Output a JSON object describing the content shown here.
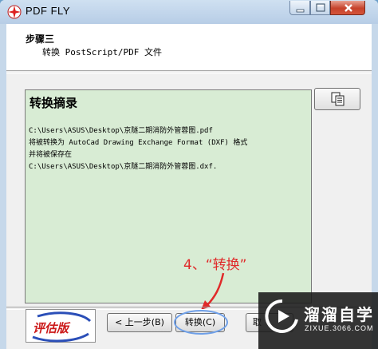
{
  "window": {
    "title": "PDF FLY"
  },
  "header": {
    "step_title": "步骤三",
    "step_subtitle": "转换 PostScript/PDF 文件"
  },
  "summary": {
    "title": "转换摘录",
    "lines": [
      "C:\\Users\\ASUS\\Desktop\\京隧二期消防外管蓉图.pdf",
      "将被转换为 AutoCad Drawing Exchange Format (DXF) 格式",
      "并将被保存在",
      "C:\\Users\\ASUS\\Desktop\\京隧二期消防外管蓉图.dxf."
    ]
  },
  "annotation": {
    "text": "4、“转换”",
    "color": "#e02a2a"
  },
  "buttons": {
    "back": "< 上一步(B)",
    "convert": "转换(C)",
    "cancel": "取"
  },
  "logo": {
    "text": "评估版"
  },
  "watermark": {
    "name": "溜溜自学",
    "url": "ZIXUE.3066.COM"
  },
  "icons": {
    "app": "pdf-fly-app-icon",
    "copy": "copy-clipboard-icon"
  },
  "colors": {
    "summary_bg": "#d8ecd4",
    "annotation": "#e02a2a",
    "close_button": "#c6422b"
  }
}
